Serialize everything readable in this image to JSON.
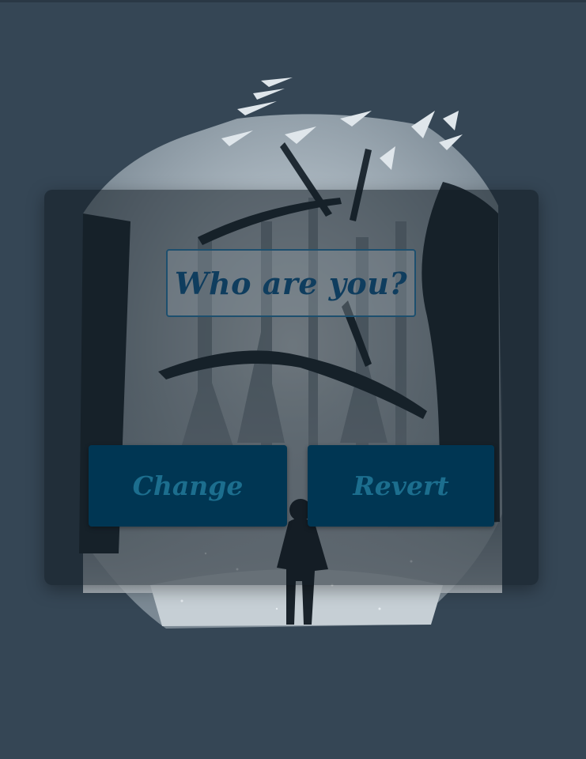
{
  "dialog": {
    "title": "Who are you?",
    "change_label": "Change",
    "revert_label": "Revert"
  },
  "colors": {
    "background": "#354655",
    "button": "#003653",
    "button_text": "#1c6e8e",
    "title_text": "#0f3d5e"
  },
  "background_image": {
    "icon": "forest-wanderer-illustration"
  }
}
